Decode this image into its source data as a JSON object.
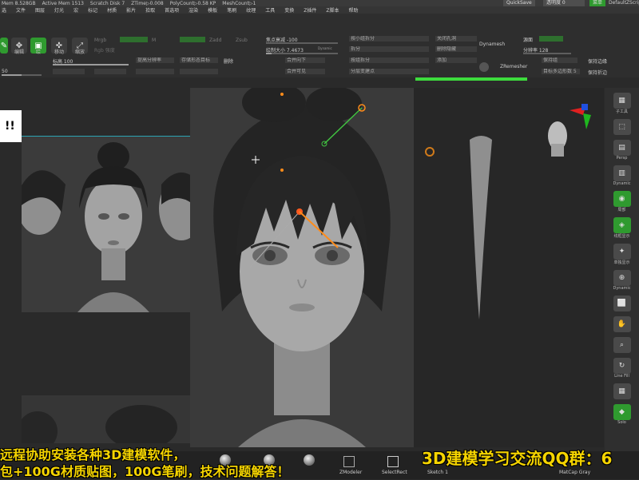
{
  "statusbar": {
    "items": [
      "Mem 8.528GB",
      "Active Mem 1513",
      "Scratch Disk 7",
      "ZTime▷0.008",
      "PolyCount▷0.58 KP",
      "MeshCount▷1"
    ],
    "quicksave": "QuickSave",
    "transparency": "透明度 0",
    "menus_btn": "菜单",
    "default_script": "DefaultZScript"
  },
  "menubar": {
    "items": [
      "选",
      "文件",
      "图层",
      "灯光",
      "宏",
      "标记",
      "材质",
      "影片",
      "拾取",
      "首选项",
      "渲染",
      "模板",
      "笔刷",
      "纹理",
      "工具",
      "变换",
      "Z插件",
      "Z脚本",
      "帮助"
    ]
  },
  "toolbar": {
    "icon_labels": [
      "绘",
      "编辑",
      "移动",
      "缩放",
      "旋转"
    ],
    "mrgb": "Mrgb",
    "rgb": "Rgb",
    "m": "M",
    "rgb_strength": "Rgb 强度",
    "zadd": "Zadd",
    "zsub": "Zsub",
    "focal_shift": "焦点衰减 -100",
    "draw_size": "绘制大小 7.4673",
    "dynamic": "Dynamic",
    "intensity": "标高 100",
    "val_50": "50",
    "btn_divide": "提高分辨率",
    "btn_store": "存储形态目标",
    "btn_drop": "删除",
    "btn_merge": "合并向下",
    "btn_split": "拆分",
    "btn_group": "按小组拆分",
    "btn_hide": "删除隐藏",
    "btn_visible": "合并可见",
    "btn_close": "关闭孔洞",
    "btn_group_split": "按组拆分",
    "btn_subdiv": "分层变建点",
    "btn_rel": "重新",
    "btn_append": "添加",
    "dynamesh": "Dynamesh",
    "zremesher": "ZRemesher",
    "resolution": "分辨率 128",
    "smooth": "源面",
    "target_polys": "目标多边形数 5",
    "keep_groups": "保持组",
    "same_groups": "保持边缘",
    "keep_edge": "保持折边"
  },
  "left_overlay": "!!",
  "right_bar": {
    "items": [
      {
        "icon": "sub-tool",
        "label": "子工具"
      },
      {
        "icon": "brush",
        "label": ""
      },
      {
        "icon": "sculpt",
        "label": "Persp"
      },
      {
        "icon": "floor",
        "label": "Dynamic"
      },
      {
        "icon": "local",
        "label": "局部"
      },
      {
        "icon": "green-xyz",
        "label": "线框显示"
      },
      {
        "icon": "solo",
        "label": "单独显示"
      },
      {
        "icon": "xyz",
        "label": "Dynamic"
      },
      {
        "icon": "frame",
        "label": ""
      },
      {
        "icon": "move",
        "label": ""
      },
      {
        "icon": "scale",
        "label": ""
      },
      {
        "icon": "rotate",
        "label": ""
      },
      {
        "icon": "linefill",
        "label": "Line Fill"
      },
      {
        "icon": "polyf",
        "label": ""
      },
      {
        "icon": "transp",
        "label": ""
      },
      {
        "icon": "solo2",
        "label": "Solo"
      }
    ]
  },
  "bottom_bar": {
    "subtitle_left_1": "远程协助安装各种3D建模软件，",
    "subtitle_left_2": "包+100G材质贴图，100G笔刷，技术问题解答！",
    "subtitle_right": "3D建模学习交流QQ群：6",
    "zmodeler": "ZModeler",
    "selectrect": "SelectRect",
    "sketch": "Sketch 1",
    "matcap": "MatCap Gray"
  },
  "colors": {
    "accent_green": "#3ddc3d",
    "button_green": "#2f9a2f",
    "subtitle_yellow": "#f5d400",
    "ref_border": "#2ba4b4"
  }
}
